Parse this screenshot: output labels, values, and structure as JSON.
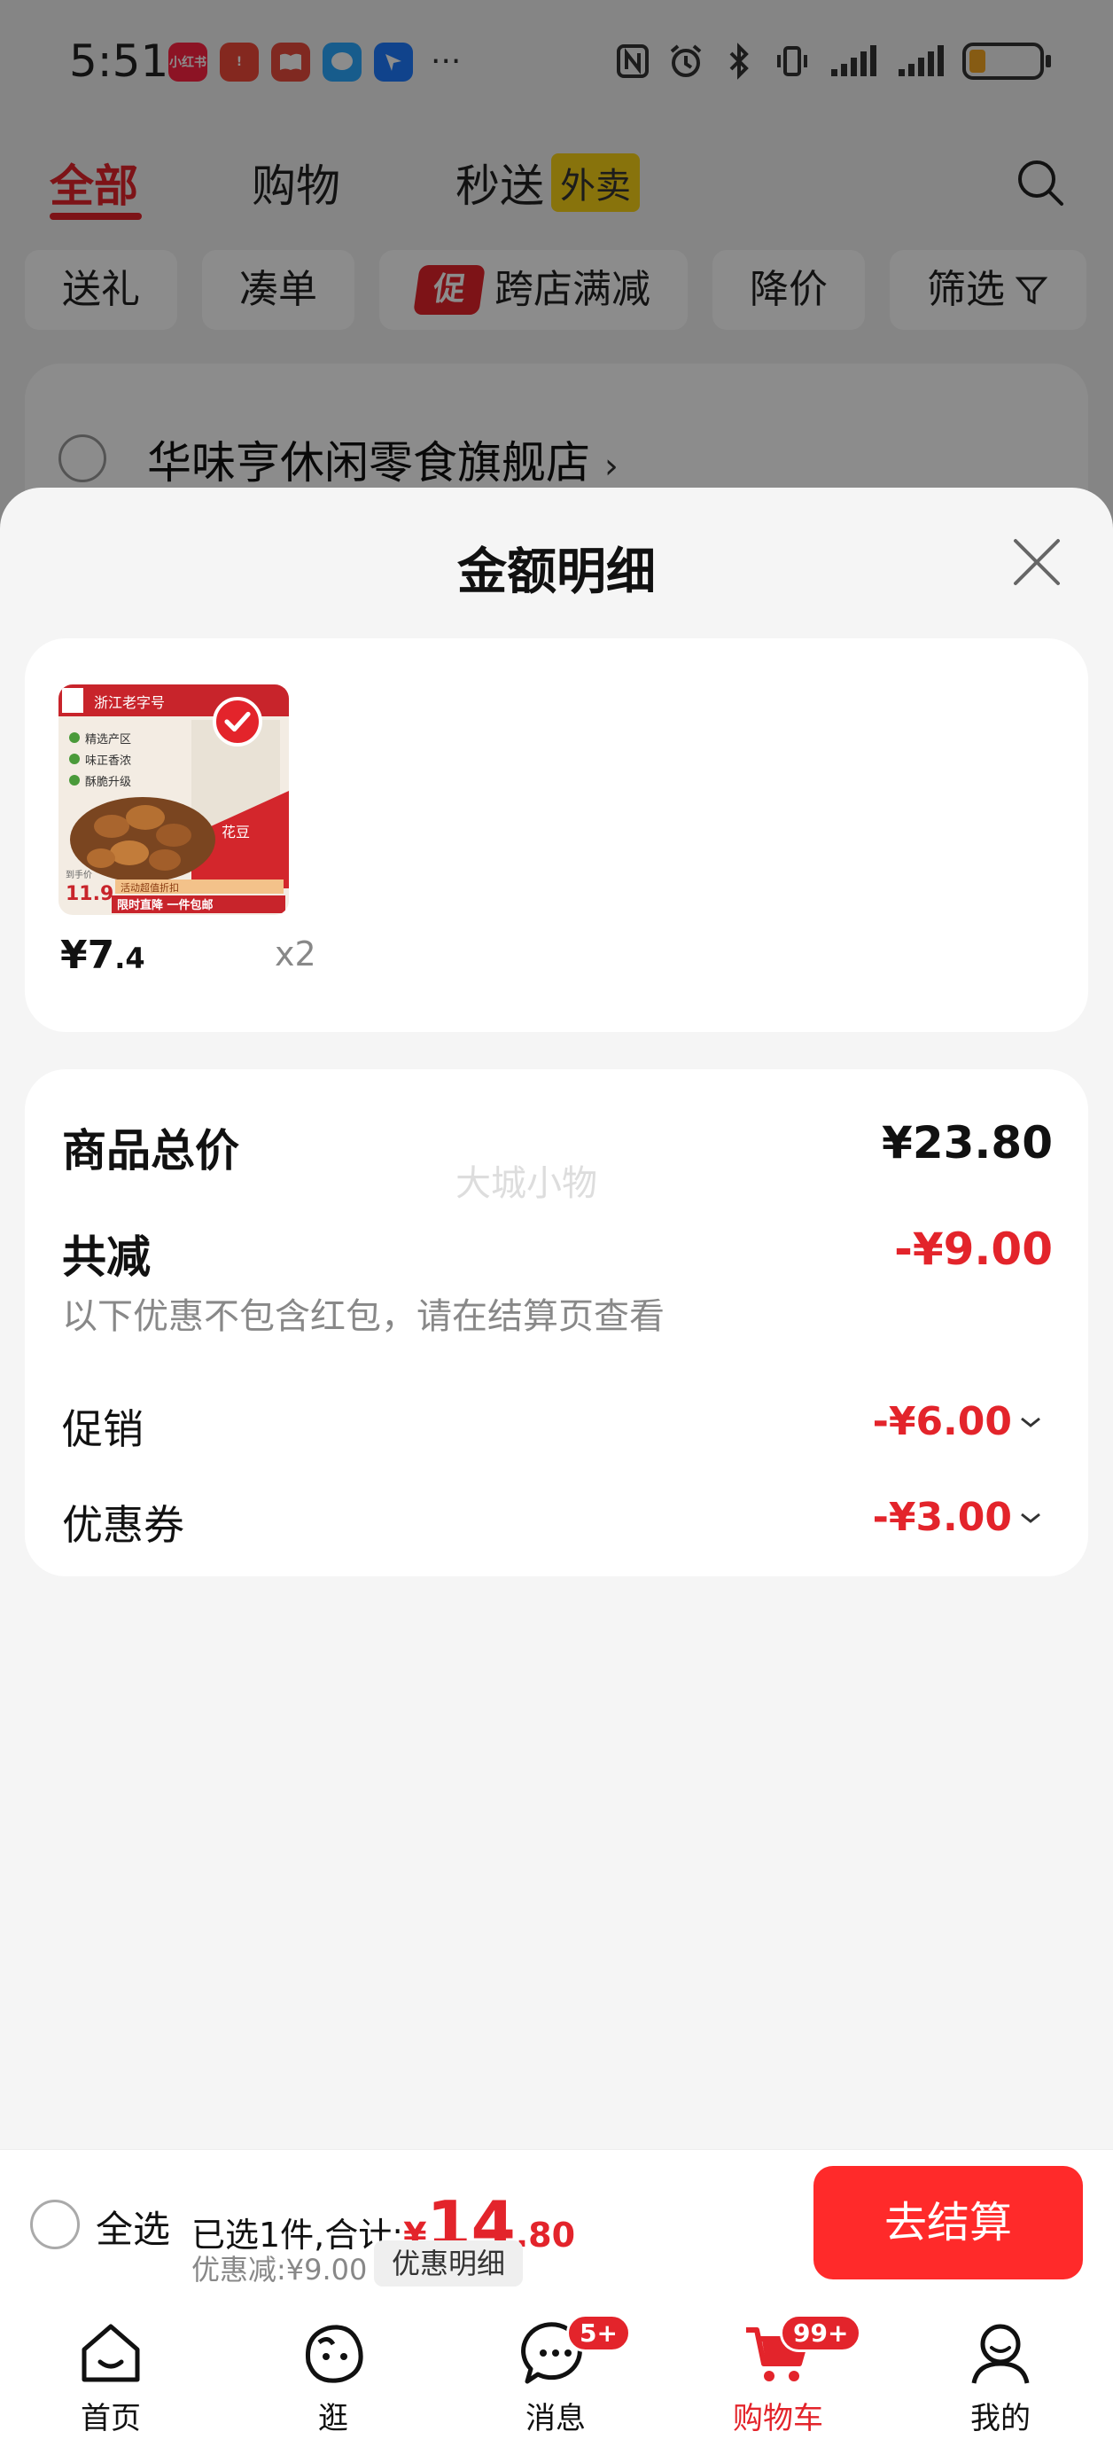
{
  "status_bar": {
    "time": "5:51",
    "app_icons": [
      {
        "name": "xiaohongshu-icon",
        "label": "小红书",
        "color": "#ff2442"
      },
      {
        "name": "app-red-icon",
        "label": "!",
        "color": "#f04a3a"
      },
      {
        "name": "reader-icon",
        "label": "",
        "color": "#e94b3c"
      },
      {
        "name": "message-app-icon",
        "label": "",
        "color": "#2aa8ff"
      },
      {
        "name": "navigation-app-icon",
        "label": "",
        "color": "#1e7bff"
      }
    ],
    "more": "···"
  },
  "background": {
    "tabs": {
      "all": "全部",
      "shopping": "购物",
      "instant": "秒送",
      "waimai": "外卖"
    },
    "chips": {
      "gift": "送礼",
      "bundle": "凑单",
      "promo_badge": "促",
      "cross_store": "跨店满减",
      "price_drop": "降价",
      "filter": "筛选"
    },
    "store_name": "华味亨休闲零食旗舰店",
    "store_chevron": "›"
  },
  "sheet": {
    "title": "金额明细",
    "product": {
      "price_int": "¥7",
      "price_dec": ".4",
      "quantity": "x2",
      "image_text": {
        "brand": "浙江老字号",
        "bullet1": "精选产区",
        "bullet2": "味正香浓",
        "bullet3": "酥脆升级",
        "name": "花豆",
        "price_label": "到手价",
        "price": "11.9",
        "promo": "活动超值折扣",
        "banner": "限时直降 一件包邮"
      }
    },
    "summary": {
      "total_label": "商品总价",
      "total_value": "¥23.80",
      "discount_label": "共减",
      "discount_value": "-¥9.00",
      "note": "以下优惠不包含红包，请在结算页查看",
      "promo_label": "促销",
      "promo_value": "-¥6.00",
      "coupon_label": "优惠券",
      "coupon_value": "-¥3.00",
      "watermark": "大城小物"
    }
  },
  "checkout": {
    "select_all": "全选",
    "selected_text": "已选1件,合计:",
    "yen": "¥",
    "total_int": "14",
    "total_dec": ".80",
    "discount_text": "优惠减:¥9.00",
    "detail_button": "优惠明细",
    "checkout_button": "去结算"
  },
  "tabbar": {
    "home": "首页",
    "browse": "逛",
    "messages": "消息",
    "messages_badge": "5+",
    "cart": "购物车",
    "cart_badge": "99+",
    "me": "我的"
  },
  "colors": {
    "accent": "#e3242b",
    "checkout": "#ff2a2a",
    "waimai_badge": "#f7d117"
  }
}
